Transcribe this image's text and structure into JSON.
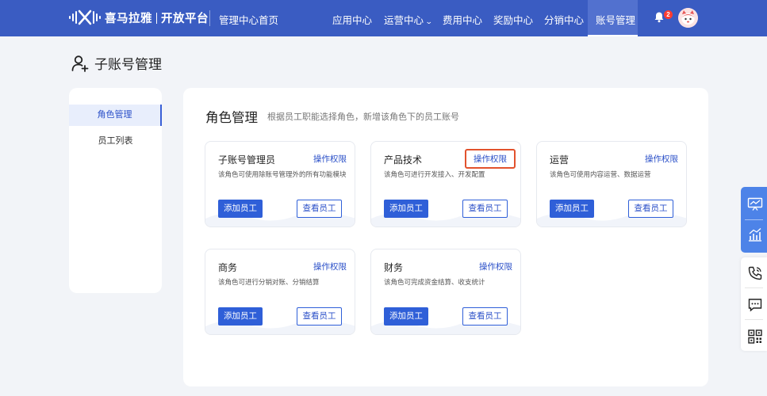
{
  "header": {
    "brand_name": "喜马拉雅",
    "brand_sub": "开放平台",
    "home_link": "管理中心首页",
    "nav": [
      {
        "label": "应用中心"
      },
      {
        "label": "运营中心"
      },
      {
        "label": "费用中心"
      },
      {
        "label": "奖励中心"
      },
      {
        "label": "分销中心"
      },
      {
        "label": "账号管理"
      }
    ],
    "active_nav": "账号管理",
    "notification_count": "2"
  },
  "page": {
    "title": "子账号管理"
  },
  "sidebar": {
    "items": [
      {
        "label": "角色管理"
      },
      {
        "label": "员工列表"
      }
    ],
    "active_item": "角色管理"
  },
  "main": {
    "title": "角色管理",
    "description": "根据员工职能选择角色，新增该角色下的员工账号",
    "roles": [
      {
        "name": "子账号管理员",
        "permission_label": "操作权限",
        "description": "该角色可使用除账号管理外的所有功能模块",
        "add_label": "添加员工",
        "view_label": "查看员工"
      },
      {
        "name": "产品技术",
        "permission_label": "操作权限",
        "description": "该角色可进行开发接入、开发配置",
        "add_label": "添加员工",
        "view_label": "查看员工"
      },
      {
        "name": "运营",
        "permission_label": "操作权限",
        "description": "该角色可使用内容运营、数据运营",
        "add_label": "添加员工",
        "view_label": "查看员工"
      },
      {
        "name": "商务",
        "permission_label": "操作权限",
        "description": "该角色可进行分销对账、分销结算",
        "add_label": "添加员工",
        "view_label": "查看员工"
      },
      {
        "name": "财务",
        "permission_label": "操作权限",
        "description": "该角色可完成资金结算、收支统计",
        "add_label": "添加员工",
        "view_label": "查看员工"
      }
    ]
  },
  "floating_toolbar": {
    "icons": [
      "presentation-icon",
      "analytics-icon",
      "phone-icon",
      "chat-icon",
      "qrcode-icon"
    ]
  },
  "colors": {
    "topbar": "#3a5cc2",
    "accent": "#2f5fd8",
    "highlight_border": "#e2522d",
    "float_blue": "#4d83e8"
  }
}
